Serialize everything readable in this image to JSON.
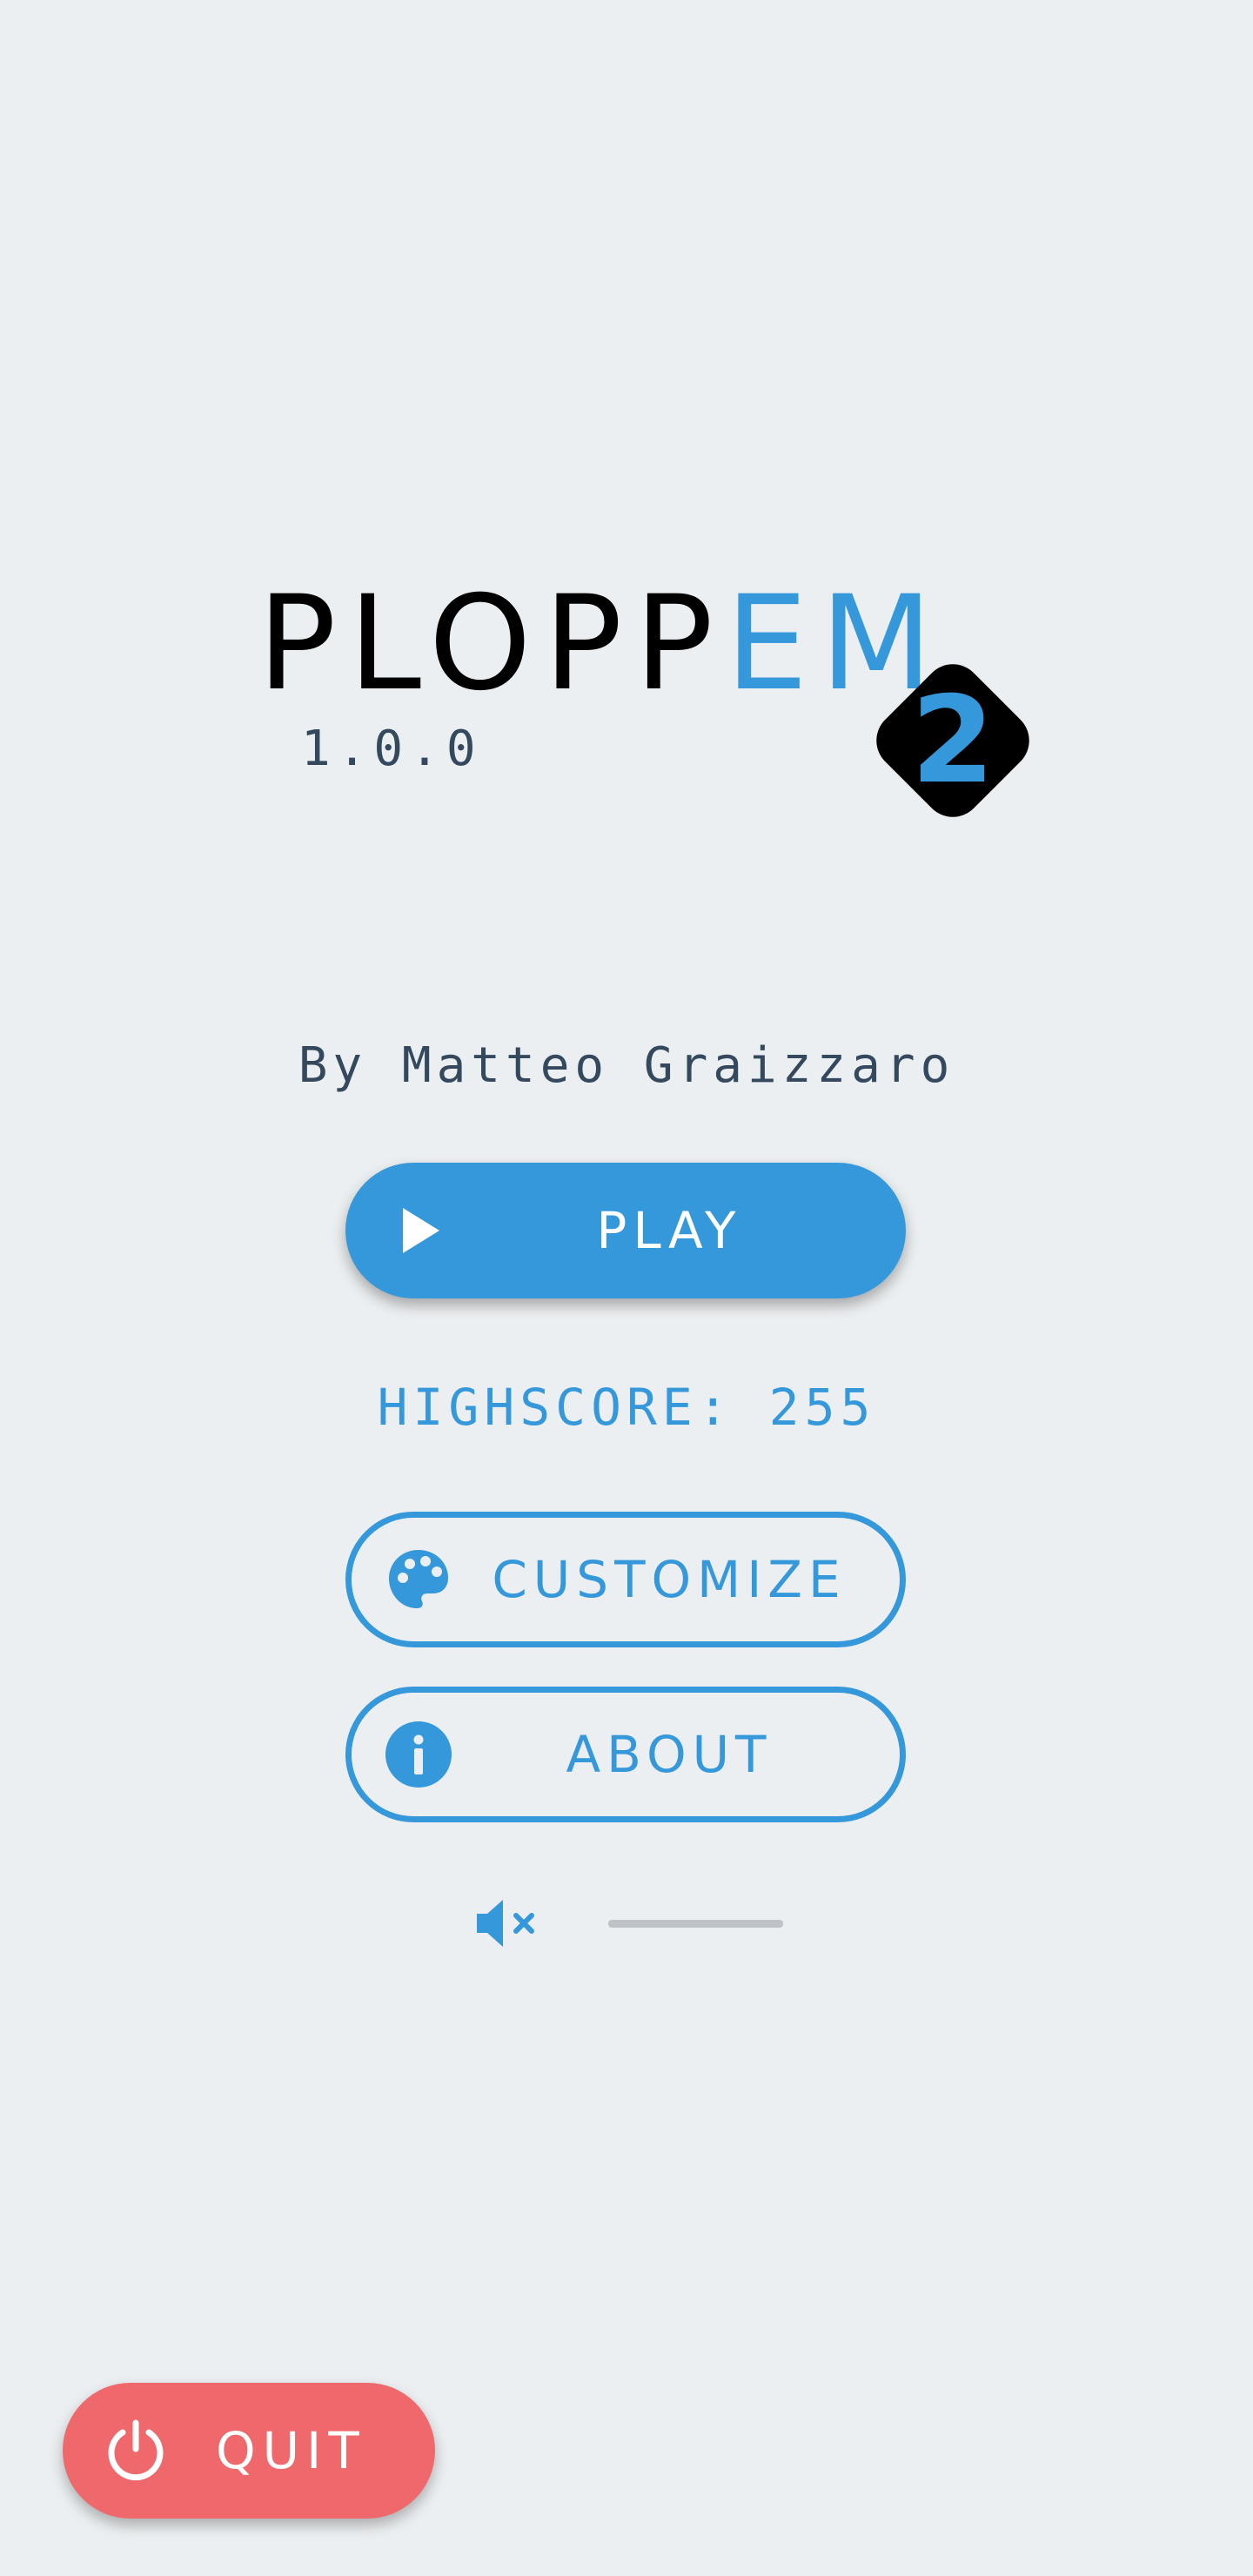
{
  "logo": {
    "text_dark": "PLOPP",
    "text_accent": "EM",
    "badge": "2"
  },
  "version": "1.0.0",
  "author": "By Matteo Graizzaro",
  "menu": {
    "play_label": "PLAY",
    "highscore": "HIGHSCORE: 255",
    "customize_label": "CUSTOMIZE",
    "about_label": "ABOUT",
    "quit_label": "QUIT"
  },
  "sound": {
    "muted": true,
    "volume": 0.0
  },
  "icons": {
    "play": "play-icon",
    "customize": "palette-icon",
    "about": "info-icon",
    "mute": "volume-mute-icon",
    "quit": "power-icon"
  },
  "colors": {
    "background": "#ECEFF1",
    "accent": "#3598DB",
    "text": "#34495E",
    "logo_dark": "#000000",
    "quit": "#EF686B",
    "slider_track": "#BDC3C7"
  }
}
